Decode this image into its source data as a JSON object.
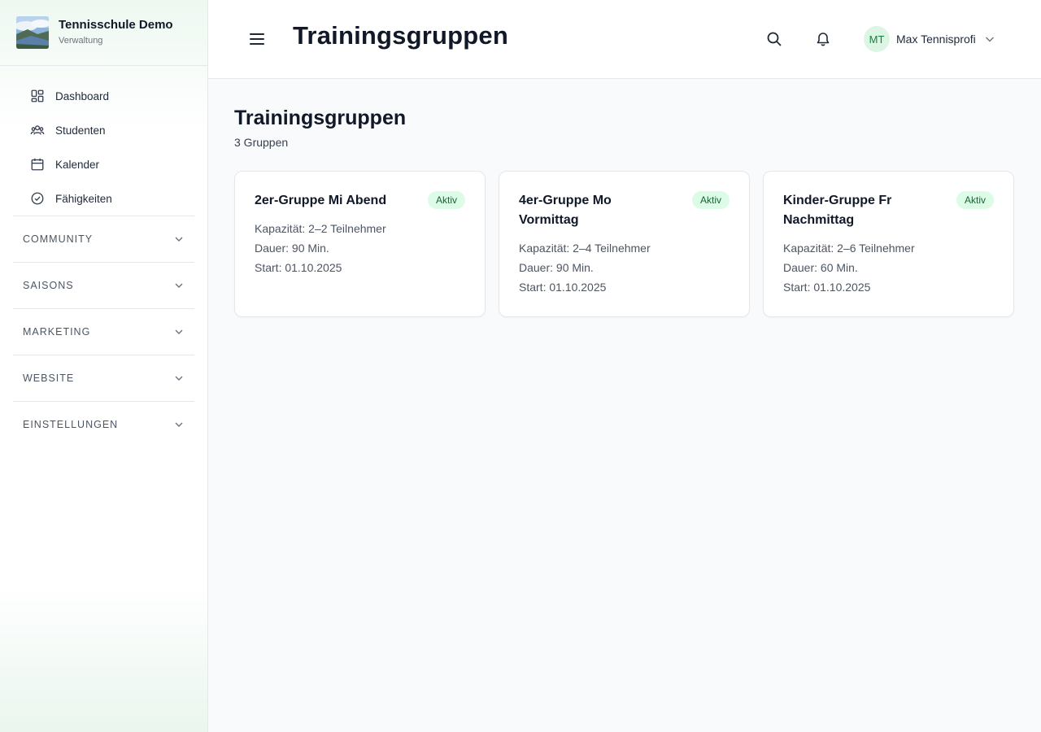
{
  "brand": {
    "title": "Tennisschule Demo",
    "subtitle": "Verwaltung"
  },
  "nav": {
    "items": [
      {
        "label": "Dashboard",
        "icon": "dashboard-icon"
      },
      {
        "label": "Studenten",
        "icon": "users-icon"
      },
      {
        "label": "Kalender",
        "icon": "calendar-icon"
      },
      {
        "label": "Fähigkeiten",
        "icon": "check-circle-icon"
      }
    ],
    "sections": [
      {
        "label": "COMMUNITY"
      },
      {
        "label": "SAISONS"
      },
      {
        "label": "MARKETING"
      },
      {
        "label": "WEBSITE"
      },
      {
        "label": "EINSTELLUNGEN"
      }
    ]
  },
  "header": {
    "title": "Trainingsgruppen",
    "user": {
      "initials": "MT",
      "name": "Max Tennisprofi"
    }
  },
  "main": {
    "title": "Trainingsgruppen",
    "count_label": "3 Gruppen",
    "cards": [
      {
        "title": "2er-Gruppe Mi Abend",
        "badge": "Aktiv",
        "capacity": "Kapazität: 2–2 Teilnehmer",
        "duration": "Dauer: 90 Min.",
        "start": "Start: 01.10.2025"
      },
      {
        "title": "4er-Gruppe Mo Vormittag",
        "badge": "Aktiv",
        "capacity": "Kapazität: 2–4 Teilnehmer",
        "duration": "Dauer: 90 Min.",
        "start": "Start: 01.10.2025"
      },
      {
        "title": "Kinder-Gruppe Fr Nachmittag",
        "badge": "Aktiv",
        "capacity": "Kapazität: 2–6 Teilnehmer",
        "duration": "Dauer: 60 Min.",
        "start": "Start: 01.10.2025"
      }
    ]
  },
  "colors": {
    "accent": "#15803d",
    "badge_bg": "#dcfce7",
    "badge_text": "#166534"
  }
}
